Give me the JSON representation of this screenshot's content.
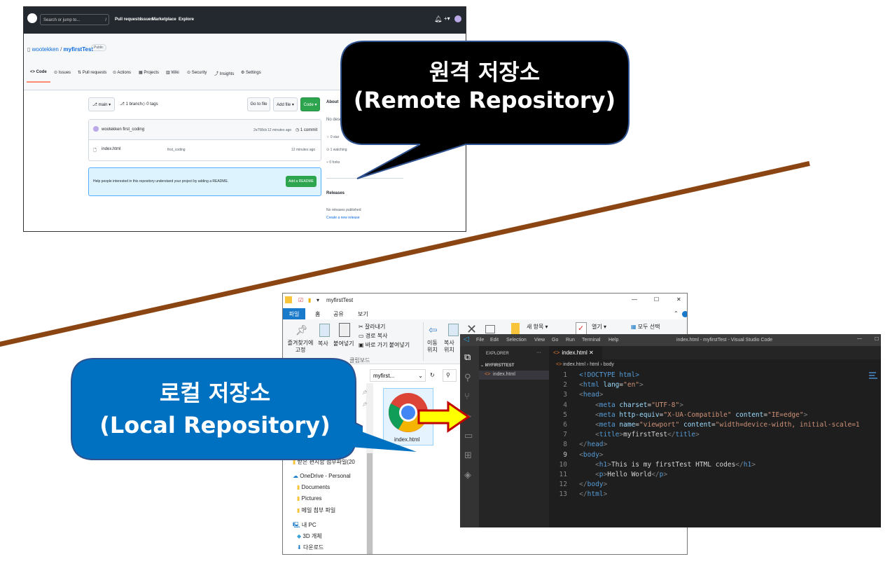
{
  "github": {
    "search_placeholder": "Search or jump to...",
    "search_key": "/",
    "nav": [
      "Pull requests",
      "Issues",
      "Marketplace",
      "Explore"
    ],
    "owner": "wootekken",
    "slash": " / ",
    "repo": "myfirstTest",
    "visibility": "Public",
    "tabs": [
      "<> Code",
      "⊙ Issues",
      "⇅ Pull requests",
      "⊙ Actions",
      "▦ Projects",
      "▥ Wiki",
      "⊙ Security",
      "⤴ Insights",
      "⚙ Settings"
    ],
    "branch_button": "⎇ main ▾",
    "branches": "⎇ 1 branch",
    "tags": "◇ 0 tags",
    "go_to_file": "Go to file",
    "add_file": "Add file ▾",
    "code_button": "Code ▾",
    "commit_author": "wootekken first_coding",
    "commit_hash": "2e758cb",
    "commit_time": "12 minutes ago",
    "commit_count": "◷ 1 commit",
    "file": {
      "name": "index.html",
      "message": "first_coding",
      "time": "12 minutes ago"
    },
    "readme_prompt": "Help people interested in this repository understand your project by adding a README.",
    "add_readme": "Add a README",
    "about_title": "About",
    "about_desc": "No desc",
    "stars": "☆ 0 star",
    "watching": "⊙ 1 watching",
    "forks": "⑂ 0 forks",
    "releases_title": "Releases",
    "no_releases": "No releases published",
    "create_release": "Create a new release"
  },
  "explorer": {
    "title": "myfirstTest",
    "window_controls": [
      "—",
      "☐",
      "✕"
    ],
    "ribbon_tabs": [
      "파일",
      "홈",
      "공유",
      "보기"
    ],
    "pin_label": "즐겨찾기에 고정",
    "copy": "복사",
    "paste": "붙여넣기",
    "cut": "잘라내기",
    "copy_path": "경로 복사",
    "paste_shortcut": "바로 가기 붙여넣기",
    "group_clipboard": "클립보드",
    "move_to": "이동 위치",
    "copy_to": "복사 위치",
    "new_item": "새 항목 ▾",
    "open": "열기 ▾",
    "select_all": "모두 선택",
    "address": "myfirst...",
    "refresh": "↻",
    "file_name": "index.html",
    "nav_items": [
      {
        "label": "받은 편지함 첨부파일(20",
        "icon": "folder"
      },
      {
        "label": "OneDrive - Personal",
        "icon": "cloud"
      },
      {
        "label": "Documents",
        "icon": "folder"
      },
      {
        "label": "Pictures",
        "icon": "folder"
      },
      {
        "label": "메일 첨부 파일",
        "icon": "folder"
      },
      {
        "label": "내 PC",
        "icon": "pc"
      },
      {
        "label": "3D 개체",
        "icon": "cube"
      },
      {
        "label": "다운로드",
        "icon": "download"
      }
    ]
  },
  "vscode": {
    "menu": [
      "File",
      "Edit",
      "Selection",
      "View",
      "Go",
      "Run",
      "Terminal",
      "Help"
    ],
    "window_title": "index.html - myfirstTest - Visual Studio Code",
    "explorer_header": "EXPLORER",
    "more": "···",
    "folder": "MYFIRSTTEST",
    "file": "index.html",
    "tab": "index.html  ✕",
    "breadcrumb": [
      "index.html",
      "html",
      "body"
    ],
    "code": [
      [
        {
          "c": "tg",
          "t": "<!DOCTYPE html"
        },
        {
          "c": "tg",
          "t": ">"
        }
      ],
      [
        {
          "c": "pn",
          "t": "<"
        },
        {
          "c": "tg",
          "t": "html "
        },
        {
          "c": "at",
          "t": "lang"
        },
        {
          "c": "tx",
          "t": "="
        },
        {
          "c": "st",
          "t": "\"en\""
        },
        {
          "c": "pn",
          "t": ">"
        }
      ],
      [
        {
          "c": "pn",
          "t": "<"
        },
        {
          "c": "tg",
          "t": "head"
        },
        {
          "c": "pn",
          "t": ">"
        }
      ],
      [
        {
          "c": "tx",
          "t": "    "
        },
        {
          "c": "pn",
          "t": "<"
        },
        {
          "c": "tg",
          "t": "meta "
        },
        {
          "c": "at",
          "t": "charset"
        },
        {
          "c": "tx",
          "t": "="
        },
        {
          "c": "st",
          "t": "\"UTF-8\""
        },
        {
          "c": "pn",
          "t": ">"
        }
      ],
      [
        {
          "c": "tx",
          "t": "    "
        },
        {
          "c": "pn",
          "t": "<"
        },
        {
          "c": "tg",
          "t": "meta "
        },
        {
          "c": "at",
          "t": "http-equiv"
        },
        {
          "c": "tx",
          "t": "="
        },
        {
          "c": "st",
          "t": "\"X-UA-Compatible\""
        },
        {
          "c": "tx",
          "t": " "
        },
        {
          "c": "at",
          "t": "content"
        },
        {
          "c": "tx",
          "t": "="
        },
        {
          "c": "st",
          "t": "\"IE=edge\""
        },
        {
          "c": "pn",
          "t": ">"
        }
      ],
      [
        {
          "c": "tx",
          "t": "    "
        },
        {
          "c": "pn",
          "t": "<"
        },
        {
          "c": "tg",
          "t": "meta "
        },
        {
          "c": "at",
          "t": "name"
        },
        {
          "c": "tx",
          "t": "="
        },
        {
          "c": "st",
          "t": "\"viewport\""
        },
        {
          "c": "tx",
          "t": " "
        },
        {
          "c": "at",
          "t": "content"
        },
        {
          "c": "tx",
          "t": "="
        },
        {
          "c": "st",
          "t": "\"width=device-width, initial-scale=1"
        }
      ],
      [
        {
          "c": "tx",
          "t": "    "
        },
        {
          "c": "pn",
          "t": "<"
        },
        {
          "c": "tg",
          "t": "title"
        },
        {
          "c": "pn",
          "t": ">"
        },
        {
          "c": "tx",
          "t": "myfirstTest"
        },
        {
          "c": "pn",
          "t": "</"
        },
        {
          "c": "tg",
          "t": "title"
        },
        {
          "c": "pn",
          "t": ">"
        }
      ],
      [
        {
          "c": "pn",
          "t": "</"
        },
        {
          "c": "tg",
          "t": "head"
        },
        {
          "c": "pn",
          "t": ">"
        }
      ],
      [
        {
          "c": "pn",
          "t": "<"
        },
        {
          "c": "tg",
          "t": "body"
        },
        {
          "c": "pn",
          "t": ">"
        }
      ],
      [
        {
          "c": "tx",
          "t": "    "
        },
        {
          "c": "pn",
          "t": "<"
        },
        {
          "c": "tg",
          "t": "h1"
        },
        {
          "c": "pn",
          "t": ">"
        },
        {
          "c": "tx",
          "t": "This is my firstTest HTML codes"
        },
        {
          "c": "pn",
          "t": "</"
        },
        {
          "c": "tg",
          "t": "h1"
        },
        {
          "c": "pn",
          "t": ">"
        }
      ],
      [
        {
          "c": "tx",
          "t": "    "
        },
        {
          "c": "pn",
          "t": "<"
        },
        {
          "c": "tg",
          "t": "p"
        },
        {
          "c": "pn",
          "t": ">"
        },
        {
          "c": "tx",
          "t": "Hello World"
        },
        {
          "c": "pn",
          "t": "</"
        },
        {
          "c": "tg",
          "t": "p"
        },
        {
          "c": "pn",
          "t": ">"
        }
      ],
      [
        {
          "c": "pn",
          "t": "</"
        },
        {
          "c": "tg",
          "t": "body"
        },
        {
          "c": "pn",
          "t": ">"
        }
      ],
      [
        {
          "c": "pn",
          "t": "</"
        },
        {
          "c": "tg",
          "t": "html"
        },
        {
          "c": "pn",
          "t": ">"
        }
      ]
    ]
  },
  "callouts": {
    "remote_ko": "원격 저장소",
    "remote_en": "(Remote Repository)",
    "local_ko": "로컬 저장소",
    "local_en": "(Local Repository)"
  },
  "colors": {
    "divider": "#8b4513",
    "callout_remote": "#000000",
    "callout_local": "#0070c0",
    "arrow": "#ffff00",
    "arrow_stroke": "#c00000"
  }
}
